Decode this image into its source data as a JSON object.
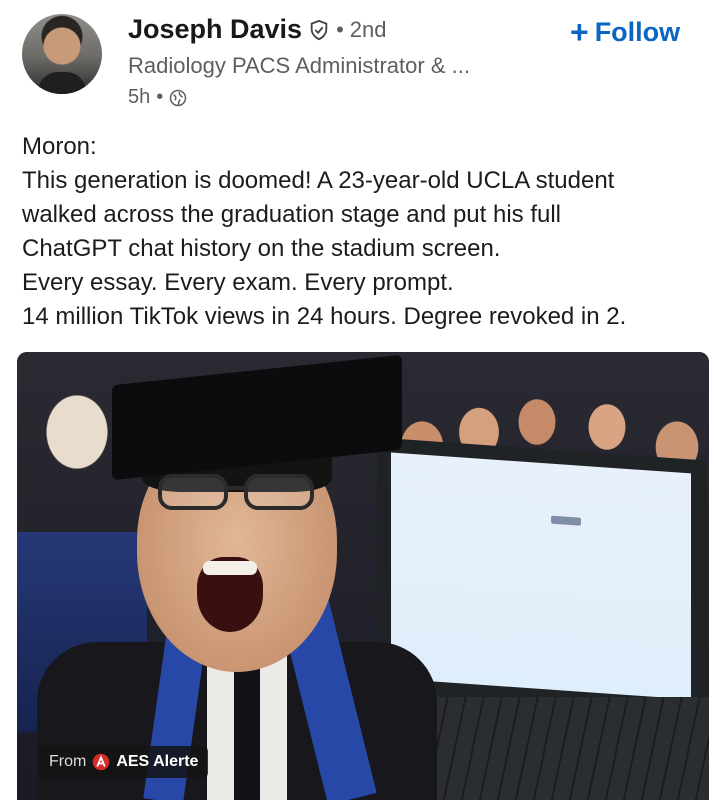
{
  "author": {
    "name": "Joseph Davis",
    "degree": "2nd",
    "headline": "Radiology PACS Administrator & ...",
    "time": "5h",
    "visibility_icon": "globe-icon"
  },
  "follow": {
    "label": "Follow",
    "icon": "plus-icon"
  },
  "post": {
    "lines": [
      "Moron:",
      "This generation is doomed! A 23-year-old UCLA student",
      "walked across the graduation stage and put his full",
      "ChatGPT chat history on the stadium screen.",
      "Every essay. Every exam. Every prompt.",
      "14 million TikTok views in 24 hours. Degree revoked in 2."
    ]
  },
  "media": {
    "source_prefix": "From",
    "source_name": "AES Alerte"
  },
  "colors": {
    "accent": "#0a66c2",
    "secondary_text": "#5e5e5e",
    "primary_text": "#191919"
  }
}
